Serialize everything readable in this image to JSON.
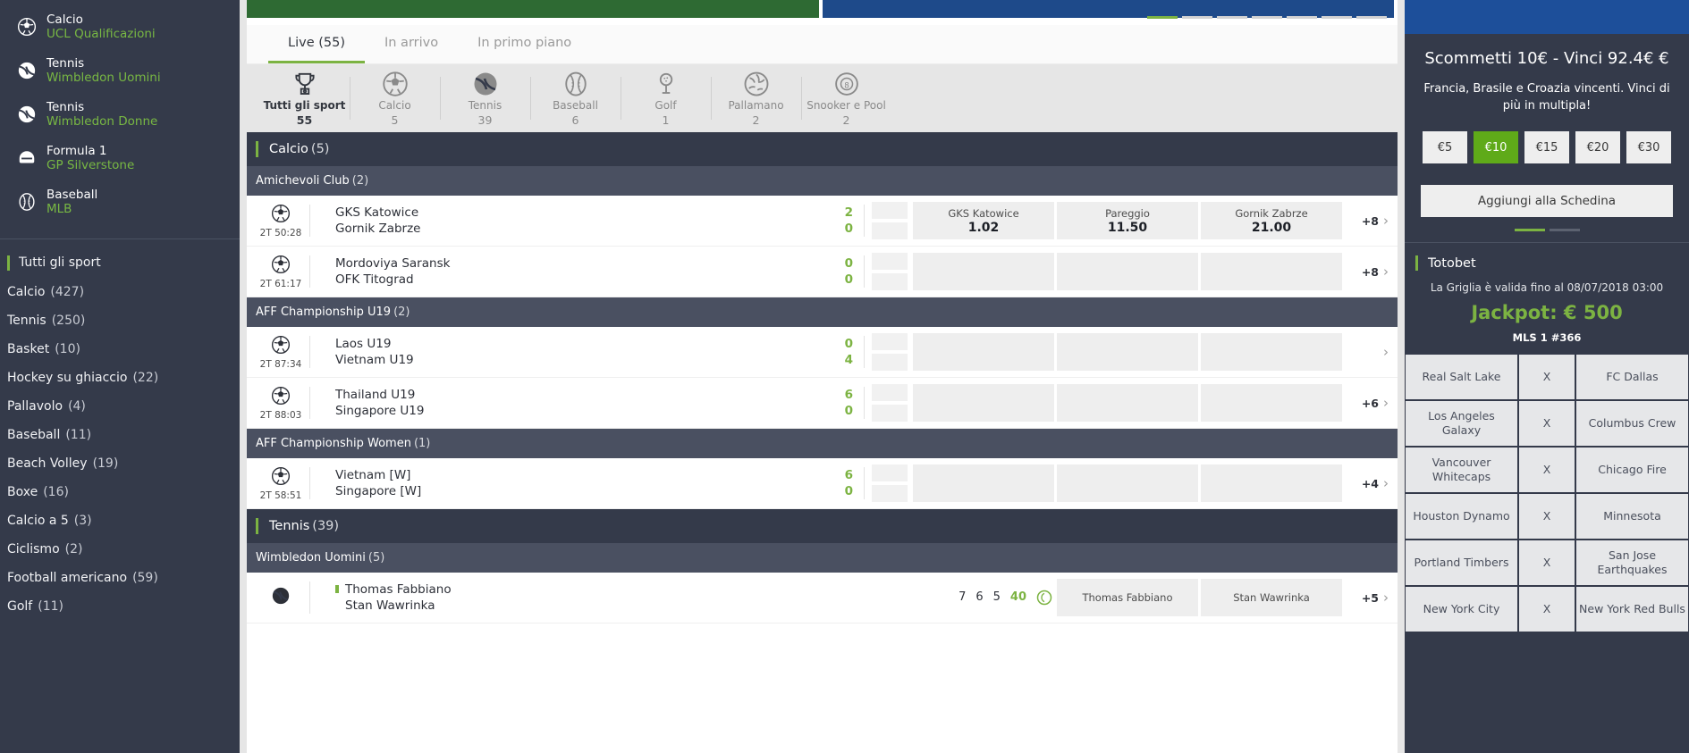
{
  "sidebar": {
    "featured": [
      {
        "sport": "Calcio",
        "league": "UCL Qualificazioni",
        "icon": "soccer-ball-icon"
      },
      {
        "sport": "Tennis",
        "league": "Wimbledon Uomini",
        "icon": "tennis-ball-icon"
      },
      {
        "sport": "Tennis",
        "league": "Wimbledon Donne",
        "icon": "tennis-ball-icon"
      },
      {
        "sport": "Formula 1",
        "league": "GP Silverstone",
        "icon": "helmet-icon"
      },
      {
        "sport": "Baseball",
        "league": "MLB",
        "icon": "baseball-icon"
      }
    ],
    "all_sports_label": "Tutti gli sport",
    "sports": [
      {
        "name": "Calcio",
        "count": "(427)"
      },
      {
        "name": "Tennis",
        "count": "(250)"
      },
      {
        "name": "Basket",
        "count": "(10)"
      },
      {
        "name": "Hockey su ghiaccio",
        "count": "(22)"
      },
      {
        "name": "Pallavolo",
        "count": "(4)"
      },
      {
        "name": "Baseball",
        "count": "(11)"
      },
      {
        "name": "Beach Volley",
        "count": "(19)"
      },
      {
        "name": "Boxe",
        "count": "(16)"
      },
      {
        "name": "Calcio a 5",
        "count": "(3)"
      },
      {
        "name": "Ciclismo",
        "count": "(2)"
      },
      {
        "name": "Football americano",
        "count": "(59)"
      },
      {
        "name": "Golf",
        "count": "(11)"
      }
    ]
  },
  "tabs": [
    {
      "label": "Live (55)",
      "active": true
    },
    {
      "label": "In arrivo",
      "active": false
    },
    {
      "label": "In primo piano",
      "active": false
    }
  ],
  "sport_filters": [
    {
      "label": "Tutti gli sport",
      "count": "55",
      "icon": "trophy-icon",
      "active": true
    },
    {
      "label": "Calcio",
      "count": "5",
      "icon": "soccer-ball-icon",
      "active": false
    },
    {
      "label": "Tennis",
      "count": "39",
      "icon": "tennis-ball-icon",
      "active": false
    },
    {
      "label": "Baseball",
      "count": "6",
      "icon": "baseball-icon",
      "active": false
    },
    {
      "label": "Golf",
      "count": "1",
      "icon": "golf-tee-icon",
      "active": false
    },
    {
      "label": "Pallamano",
      "count": "2",
      "icon": "handball-icon",
      "active": false
    },
    {
      "label": "Snooker e Pool",
      "count": "2",
      "icon": "snooker-ball-icon",
      "active": false
    }
  ],
  "sections": [
    {
      "title": "Calcio",
      "count": "(5)",
      "leagues": [
        {
          "name": "Amichevoli Club",
          "count": "(2)",
          "matches": [
            {
              "time": "2T 50:28",
              "icon": "soccer-ball-icon",
              "home": "GKS Katowice",
              "away": "Gornik Zabrze",
              "home_score": "2",
              "away_score": "0",
              "odds": [
                {
                  "name": "GKS Katowice",
                  "value": "1.02"
                },
                {
                  "name": "Pareggio",
                  "value": "11.50"
                },
                {
                  "name": "Gornik Zabrze",
                  "value": "21.00"
                }
              ],
              "more": "+8"
            },
            {
              "time": "2T 61:17",
              "icon": "soccer-ball-icon",
              "home": "Mordoviya Saransk",
              "away": "OFK Titograd",
              "home_score": "0",
              "away_score": "0",
              "odds": [
                {
                  "name": "",
                  "value": ""
                },
                {
                  "name": "",
                  "value": ""
                },
                {
                  "name": "",
                  "value": ""
                }
              ],
              "more": "+8"
            }
          ]
        },
        {
          "name": "AFF Championship U19",
          "count": "(2)",
          "matches": [
            {
              "time": "2T 87:34",
              "icon": "soccer-ball-icon",
              "home": "Laos U19",
              "away": "Vietnam U19",
              "home_score": "0",
              "away_score": "4",
              "odds": [
                {
                  "name": "",
                  "value": ""
                },
                {
                  "name": "",
                  "value": ""
                },
                {
                  "name": "",
                  "value": ""
                }
              ],
              "more": ""
            },
            {
              "time": "2T 88:03",
              "icon": "soccer-ball-icon",
              "home": "Thailand U19",
              "away": "Singapore U19",
              "home_score": "6",
              "away_score": "0",
              "odds": [
                {
                  "name": "",
                  "value": ""
                },
                {
                  "name": "",
                  "value": ""
                },
                {
                  "name": "",
                  "value": ""
                }
              ],
              "more": "+6"
            }
          ]
        },
        {
          "name": "AFF Championship Women",
          "count": "(1)",
          "matches": [
            {
              "time": "2T 58:51",
              "icon": "soccer-ball-icon",
              "home": "Vietnam [W]",
              "away": "Singapore [W]",
              "home_score": "6",
              "away_score": "0",
              "odds": [
                {
                  "name": "",
                  "value": ""
                },
                {
                  "name": "",
                  "value": ""
                },
                {
                  "name": "",
                  "value": ""
                }
              ],
              "more": "+4"
            }
          ]
        }
      ]
    },
    {
      "title": "Tennis",
      "count": "(39)",
      "leagues": [
        {
          "name": "Wimbledon Uomini",
          "count": "(5)",
          "matches": [
            {
              "time": "",
              "icon": "tennis-ball-icon",
              "home": "Thomas Fabbiano",
              "away": "Stan Wawrinka",
              "sets_home": [
                "7",
                "6",
                "5",
                "40"
              ],
              "sets_away": [
                "",
                "",
                "",
                ""
              ],
              "serving": true,
              "odds": [
                {
                  "name": "Thomas Fabbiano",
                  "value": ""
                },
                {
                  "name": "Stan Wawrinka",
                  "value": ""
                }
              ],
              "more": "+5"
            }
          ]
        }
      ]
    }
  ],
  "promo": {
    "title": "Scommetti 10€ - Vinci 92.4€ €",
    "subtitle": "Francia, Brasile e Croazia vincenti. Vinci di più in multipla!",
    "amounts": [
      {
        "label": "€5",
        "selected": false
      },
      {
        "label": "€10",
        "selected": true
      },
      {
        "label": "€15",
        "selected": false
      },
      {
        "label": "€20",
        "selected": false
      },
      {
        "label": "€30",
        "selected": false
      }
    ],
    "add_button": "Aggiungi alla Schedina"
  },
  "totobet": {
    "title": "Totobet",
    "validity": "La Griglia è valida fino al 08/07/2018 03:00",
    "jackpot": "Jackpot: € 500",
    "mls": "MLS 1 #366",
    "draw_label": "X",
    "rows": [
      {
        "home": "Real Salt Lake",
        "away": "FC Dallas"
      },
      {
        "home": "Los Angeles Galaxy",
        "away": "Columbus Crew"
      },
      {
        "home": "Vancouver Whitecaps",
        "away": "Chicago Fire"
      },
      {
        "home": "Houston Dynamo",
        "away": "Minnesota"
      },
      {
        "home": "Portland Timbers",
        "away": "San Jose Earthquakes"
      },
      {
        "home": "New York City",
        "away": "New York Red Bulls"
      }
    ]
  },
  "colors": {
    "accent_green": "#7cb342",
    "dark_navy": "#343a4a",
    "league_gray": "#4a5061"
  }
}
